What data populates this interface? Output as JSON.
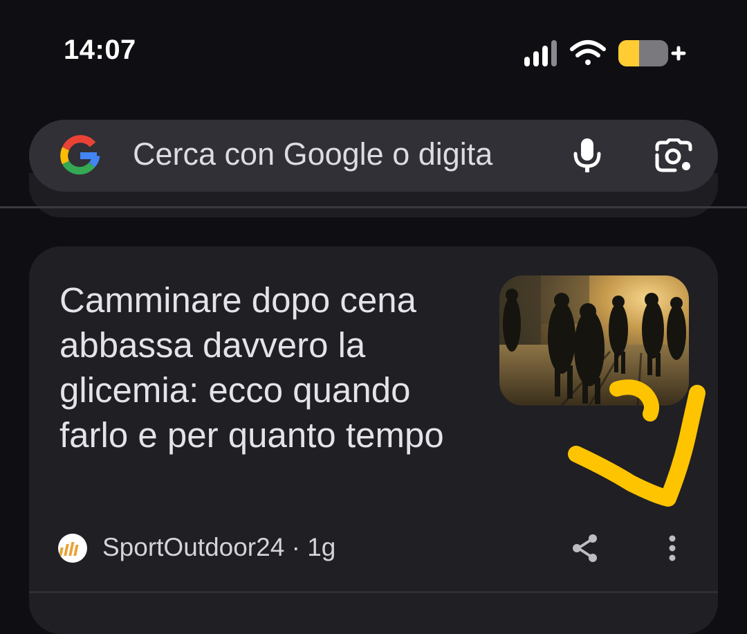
{
  "status_bar": {
    "time": "14:07",
    "icons": [
      "signal-icon",
      "wifi-icon",
      "battery-charging-icon"
    ],
    "battery_color": "#ffcc33"
  },
  "search": {
    "placeholder": "Cerca con Google o digita",
    "icons": [
      "google-logo",
      "mic-icon",
      "lens-icon"
    ]
  },
  "article": {
    "title": "Camminare dopo cena abbassa davvero la glicemia: ecco quando farlo e per quanto tempo",
    "source": "SportOutdoor24",
    "separator": " · ",
    "age": "1g",
    "thumbnail_icon": "people-walking-sunset-photo",
    "actions": [
      "share-icon",
      "more-vert-icon"
    ]
  },
  "annotation": {
    "icon": "hand-drawn-arrow",
    "color": "#ffc400"
  }
}
